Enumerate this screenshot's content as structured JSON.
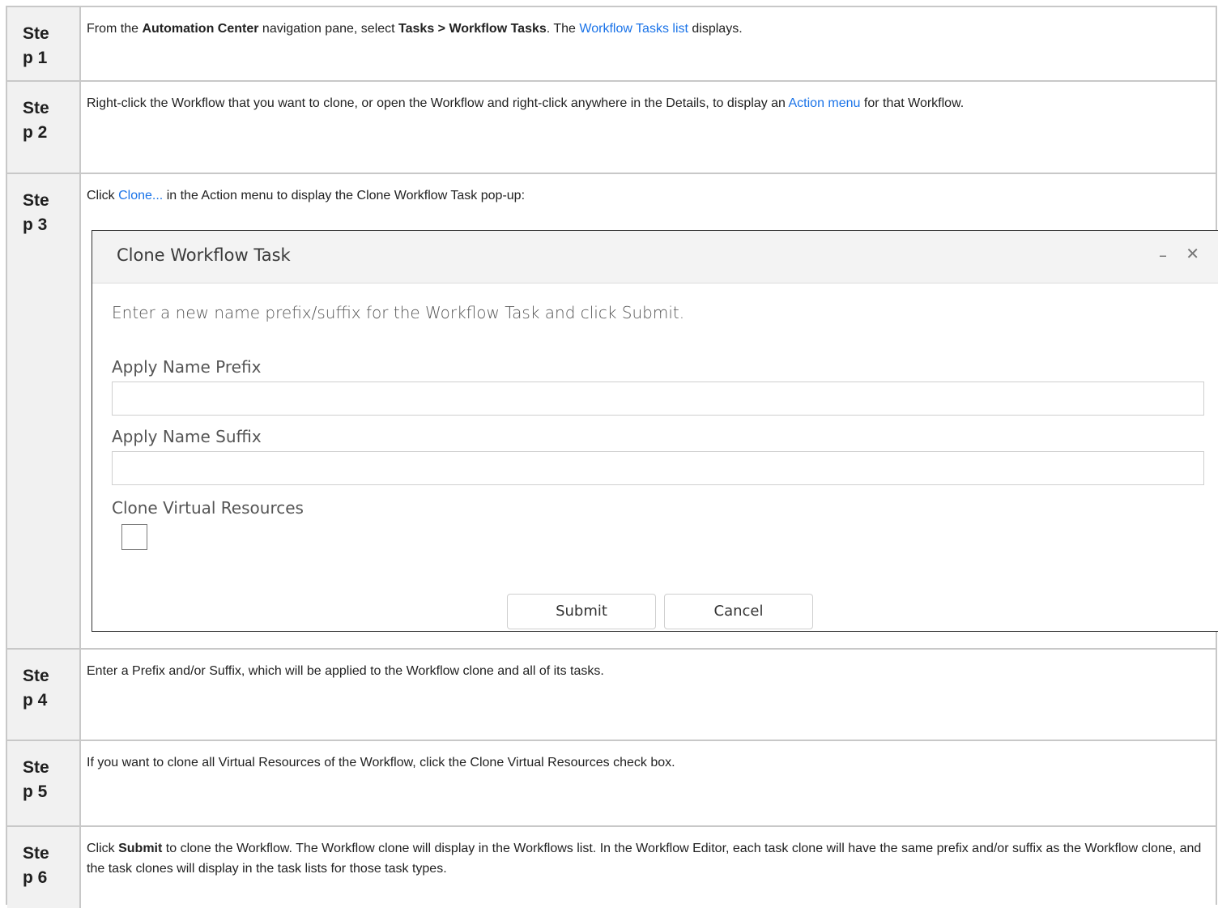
{
  "steps": [
    {
      "label": "Ste p 1",
      "parts": [
        {
          "t": "From the "
        },
        {
          "t": "Automation Center",
          "b": true
        },
        {
          "t": " navigation pane, select "
        },
        {
          "t": "Tasks > Workflow Tasks",
          "b": true
        },
        {
          "t": ". The "
        },
        {
          "t": "Workflow Tasks list",
          "link": true
        },
        {
          "t": " displays."
        }
      ]
    },
    {
      "label": "Ste p 2",
      "parts": [
        {
          "t": "Right-click the Workflow that you want to clone, or open the Workflow and right-click anywhere in the Details, to display an "
        },
        {
          "t": "Action menu",
          "link": true
        },
        {
          "t": " for that Workflow."
        }
      ]
    },
    {
      "label": "Ste p 3",
      "parts": [
        {
          "t": "Click "
        },
        {
          "t": "Clone...",
          "link": true
        },
        {
          "t": " in the Action menu to display the Clone Workflow Task pop-up:"
        }
      ]
    },
    {
      "label": "Ste p 4",
      "parts": [
        {
          "t": "Enter a Prefix and/or Suffix, which will be applied to the Workflow clone and all of its tasks."
        }
      ]
    },
    {
      "label": "Ste p 5",
      "parts": [
        {
          "t": "If you want to clone all Virtual Resources of the Workflow, click the Clone Virtual Resources check box."
        }
      ]
    },
    {
      "label": "Ste p 6",
      "parts": [
        {
          "t": "Click "
        },
        {
          "t": "Submit",
          "b": true
        },
        {
          "t": " to clone the Workflow. The Workflow clone will display in the Workflows list. In the Workflow Editor, each task clone will have the same prefix and/or suffix as the Workflow clone, and the task clones will display in the task lists for those task types."
        }
      ]
    }
  ],
  "dialog": {
    "title": "Clone Workflow Task",
    "minimize_icon": "minimize-icon",
    "close_icon": "close-icon",
    "prompt": "Enter a new name prefix/suffix for the Workflow Task and click Submit.",
    "prefix_label": "Apply Name Prefix",
    "prefix_value": "",
    "suffix_label": "Apply Name Suffix",
    "suffix_value": "",
    "clone_resources_label": "Clone Virtual Resources",
    "clone_resources_checked": false,
    "submit_label": "Submit",
    "cancel_label": "Cancel"
  },
  "colors": {
    "link": "#1a73e8",
    "label_bg": "#f1f1f1",
    "border": "#c8c8c8"
  }
}
